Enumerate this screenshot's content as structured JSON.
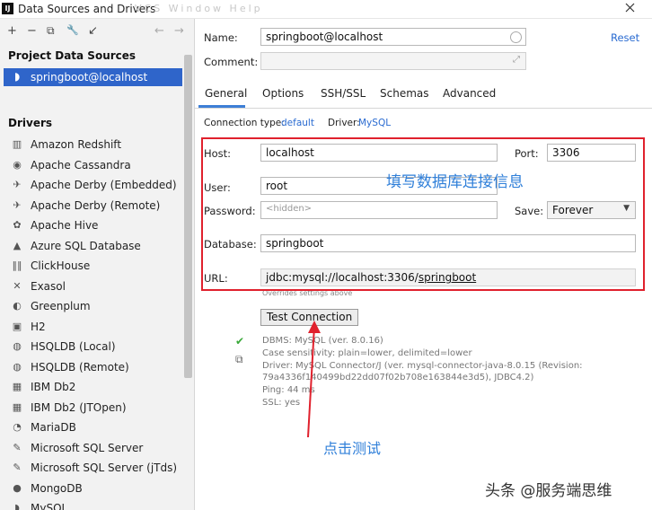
{
  "window": {
    "title": "Data Sources and Drivers",
    "app_badge": "IJ",
    "ghost_menu": "VCS Window Help"
  },
  "toolbar": {
    "add": "+",
    "remove": "−",
    "copy": "⧉",
    "wrench": "🔧",
    "pin": "↙",
    "back": "←",
    "forward": "→"
  },
  "project_sources": {
    "title": "Project Data Sources",
    "items": [
      {
        "label": "springboot@localhost"
      }
    ]
  },
  "drivers": {
    "title": "Drivers",
    "items": [
      {
        "label": "Amazon Redshift",
        "icon": "redshift-icon",
        "glyph": "▥"
      },
      {
        "label": "Apache Cassandra",
        "icon": "cassandra-icon",
        "glyph": "◉"
      },
      {
        "label": "Apache Derby (Embedded)",
        "icon": "derby-icon",
        "glyph": "✈"
      },
      {
        "label": "Apache Derby (Remote)",
        "icon": "derby-icon",
        "glyph": "✈"
      },
      {
        "label": "Apache Hive",
        "icon": "hive-icon",
        "glyph": "✿"
      },
      {
        "label": "Azure SQL Database",
        "icon": "azure-icon",
        "glyph": "▲"
      },
      {
        "label": "ClickHouse",
        "icon": "clickhouse-icon",
        "glyph": "‖‖"
      },
      {
        "label": "Exasol",
        "icon": "exasol-icon",
        "glyph": "✕"
      },
      {
        "label": "Greenplum",
        "icon": "greenplum-icon",
        "glyph": "◐"
      },
      {
        "label": "H2",
        "icon": "h2-icon",
        "glyph": "▣"
      },
      {
        "label": "HSQLDB (Local)",
        "icon": "hsqldb-icon",
        "glyph": "◍"
      },
      {
        "label": "HSQLDB (Remote)",
        "icon": "hsqldb-icon",
        "glyph": "◍"
      },
      {
        "label": "IBM Db2",
        "icon": "db2-icon",
        "glyph": "▦"
      },
      {
        "label": "IBM Db2 (JTOpen)",
        "icon": "db2-icon",
        "glyph": "▦"
      },
      {
        "label": "MariaDB",
        "icon": "mariadb-icon",
        "glyph": "◔"
      },
      {
        "label": "Microsoft SQL Server",
        "icon": "mssql-icon",
        "glyph": "✎"
      },
      {
        "label": "Microsoft SQL Server (jTds)",
        "icon": "mssql-icon",
        "glyph": "✎"
      },
      {
        "label": "MongoDB",
        "icon": "mongodb-icon",
        "glyph": "●"
      },
      {
        "label": "MySQL",
        "icon": "mysql-icon",
        "glyph": "◗"
      }
    ]
  },
  "form": {
    "name_label": "Name:",
    "name_value": "springboot@localhost",
    "comment_label": "Comment:",
    "comment_value": "",
    "reset": "Reset",
    "tabs": [
      "General",
      "Options",
      "SSH/SSL",
      "Schemas",
      "Advanced"
    ],
    "conn_type_label": "Connection type:",
    "conn_type_value": "default",
    "driver_label": "Driver:",
    "driver_value": "MySQL",
    "host_label": "Host:",
    "host_value": "localhost",
    "port_label": "Port:",
    "port_value": "3306",
    "user_label": "User:",
    "user_value": "root",
    "password_label": "Password:",
    "password_value": "<hidden>",
    "save_label": "Save:",
    "save_value": "Forever",
    "database_label": "Database:",
    "database_value": "springboot",
    "url_label": "URL:",
    "url_prefix": "jdbc:mysql://localhost:3306/",
    "url_db": "springboot",
    "overrides_note": "Overrides settings above",
    "test_button": "Test Connection"
  },
  "test_result": {
    "lines": [
      "DBMS: MySQL (ver. 8.0.16)",
      "Case sensitivity: plain=lower, delimited=lower",
      "Driver: MySQL Connector/J (ver. mysql-connector-java-8.0.15 (Revision:",
      "79a4336f140499bd22dd07f02b708e163844e3d5), JDBC4.2)",
      "Ping: 44 ms",
      "SSL: yes"
    ]
  },
  "annotations": {
    "fill_info": "填写数据库连接信息",
    "click_test": "点击测试"
  },
  "watermark": "头条 @服务端思维",
  "colors": {
    "selection": "#2f65ca",
    "annotation": "#e0212d",
    "annotation_text": "#2f7fd9",
    "link": "#2a6bd1"
  }
}
